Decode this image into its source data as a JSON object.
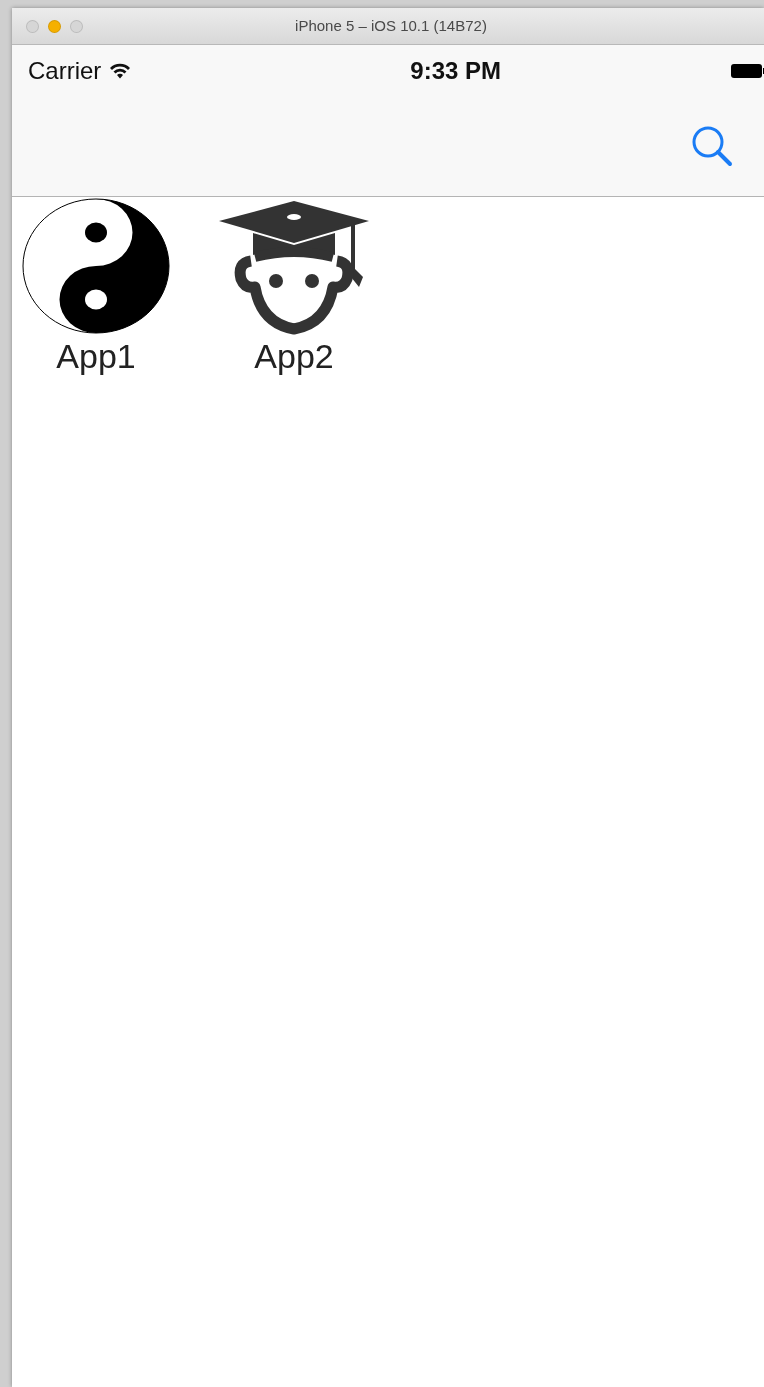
{
  "window": {
    "title": "iPhone 5 – iOS 10.1 (14B72)",
    "buttons": [
      {
        "color": "#d6d6d6"
      },
      {
        "color": "#f5b000"
      },
      {
        "color": "#d6d6d6"
      }
    ]
  },
  "status_bar": {
    "carrier": "Carrier",
    "time": "9:33 PM"
  },
  "apps": [
    {
      "label": "App1",
      "kind": "yin-yang"
    },
    {
      "label": "App2",
      "kind": "graduate"
    }
  ]
}
